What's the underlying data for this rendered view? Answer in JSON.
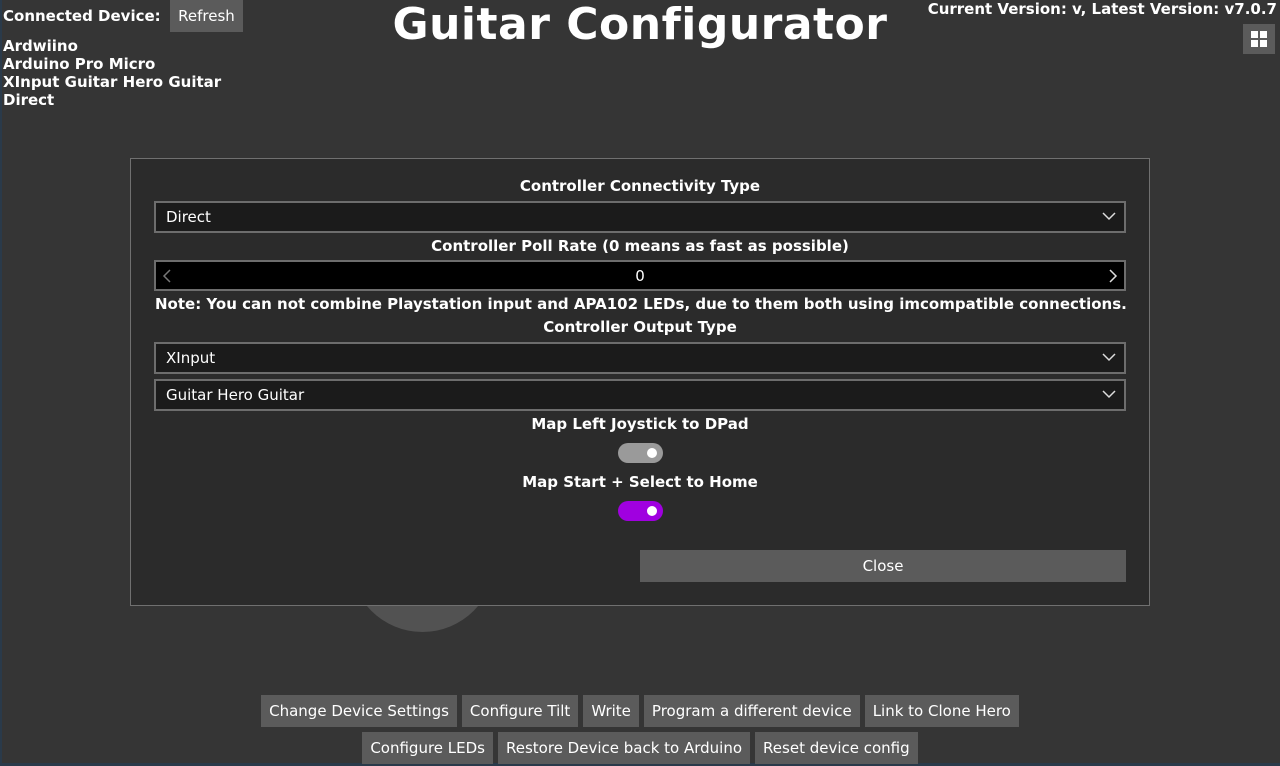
{
  "header": {
    "connected_label": "Connected Device:",
    "refresh_label": "Refresh",
    "device_lines": [
      "Ardwiino",
      "Arduino Pro Micro",
      "XInput Guitar Hero Guitar",
      "Direct"
    ],
    "title": "Guitar Configurator",
    "version_text": "Current Version: v, Latest Version: v7.0.7",
    "grid_icon": "grid-icon"
  },
  "dialog": {
    "connectivity_heading": "Controller Connectivity Type",
    "connectivity_value": "Direct",
    "poll_heading": "Controller Poll Rate (0 means as fast as possible)",
    "poll_value": "0",
    "note": "Note: You can not combine Playstation input and APA102 LEDs, due to them both using imcompatible connections.",
    "output_heading": "Controller Output Type",
    "output_value": "XInput",
    "subtype_value": "Guitar Hero Guitar",
    "map_joystick_heading": "Map Left Joystick to DPad",
    "map_joystick_on": false,
    "map_home_heading": "Map Start + Select to Home",
    "map_home_on": true,
    "close_label": "Close"
  },
  "buttons": {
    "row1": [
      "Change Device Settings",
      "Configure Tilt",
      "Write",
      "Program a different device",
      "Link to Clone Hero"
    ],
    "row2": [
      "Configure LEDs",
      "Restore Device back to Arduino",
      "Reset device config"
    ]
  },
  "colors": {
    "background": "#353535",
    "dialog": "#2b2b2b",
    "button": "#5b5b5b",
    "toggle_on": "#a000e0",
    "toggle_off": "#9a9a9a"
  }
}
